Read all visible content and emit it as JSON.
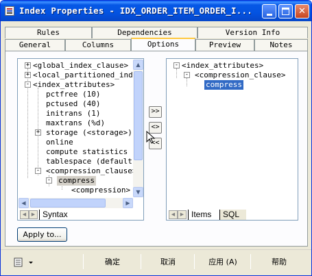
{
  "window": {
    "title": "Index Properties - IDX_ORDER_ITEM_ORDER_I...",
    "controls": [
      "minimize",
      "maximize",
      "close"
    ]
  },
  "tabs": {
    "row1": [
      "Rules",
      "Dependencies",
      "Version Info"
    ],
    "row2": [
      "General",
      "Columns",
      "Options",
      "Preview",
      "Notes"
    ],
    "active": "Options"
  },
  "left_tree": {
    "items": [
      {
        "text": "<global_index_clause>",
        "expander": "+"
      },
      {
        "text": "<local_partitioned_index",
        "expander": "+"
      },
      {
        "text": "<index_attributes>",
        "expander": "-"
      },
      {
        "text": "pctfree (10)"
      },
      {
        "text": "pctused (40)"
      },
      {
        "text": "initrans (1)"
      },
      {
        "text": "maxtrans (%d)"
      },
      {
        "text": "storage (<storage>)",
        "expander": "+"
      },
      {
        "text": "online"
      },
      {
        "text": "compute statistics"
      },
      {
        "text": "tablespace (default)"
      },
      {
        "text": "<compression_clause>",
        "expander": "-"
      },
      {
        "text": "compress",
        "expander": "-"
      },
      {
        "text": "<compression>"
      }
    ],
    "bottom_tab": "Syntax"
  },
  "middle_buttons": [
    ">>",
    "<>",
    "<<"
  ],
  "right_tree": {
    "items": [
      {
        "text": "<index_attributes>",
        "expander": "-"
      },
      {
        "text": "<compression_clause>",
        "expander": "-"
      },
      {
        "text": "compress",
        "selected": true
      }
    ],
    "bottom_tabs": [
      "Items",
      "SQL"
    ]
  },
  "apply_to_label": "Apply to...",
  "footer": {
    "menu_icon": "list-icon",
    "ok": "确定",
    "cancel": "取消",
    "apply": "应用 (A)",
    "help": "帮助"
  }
}
